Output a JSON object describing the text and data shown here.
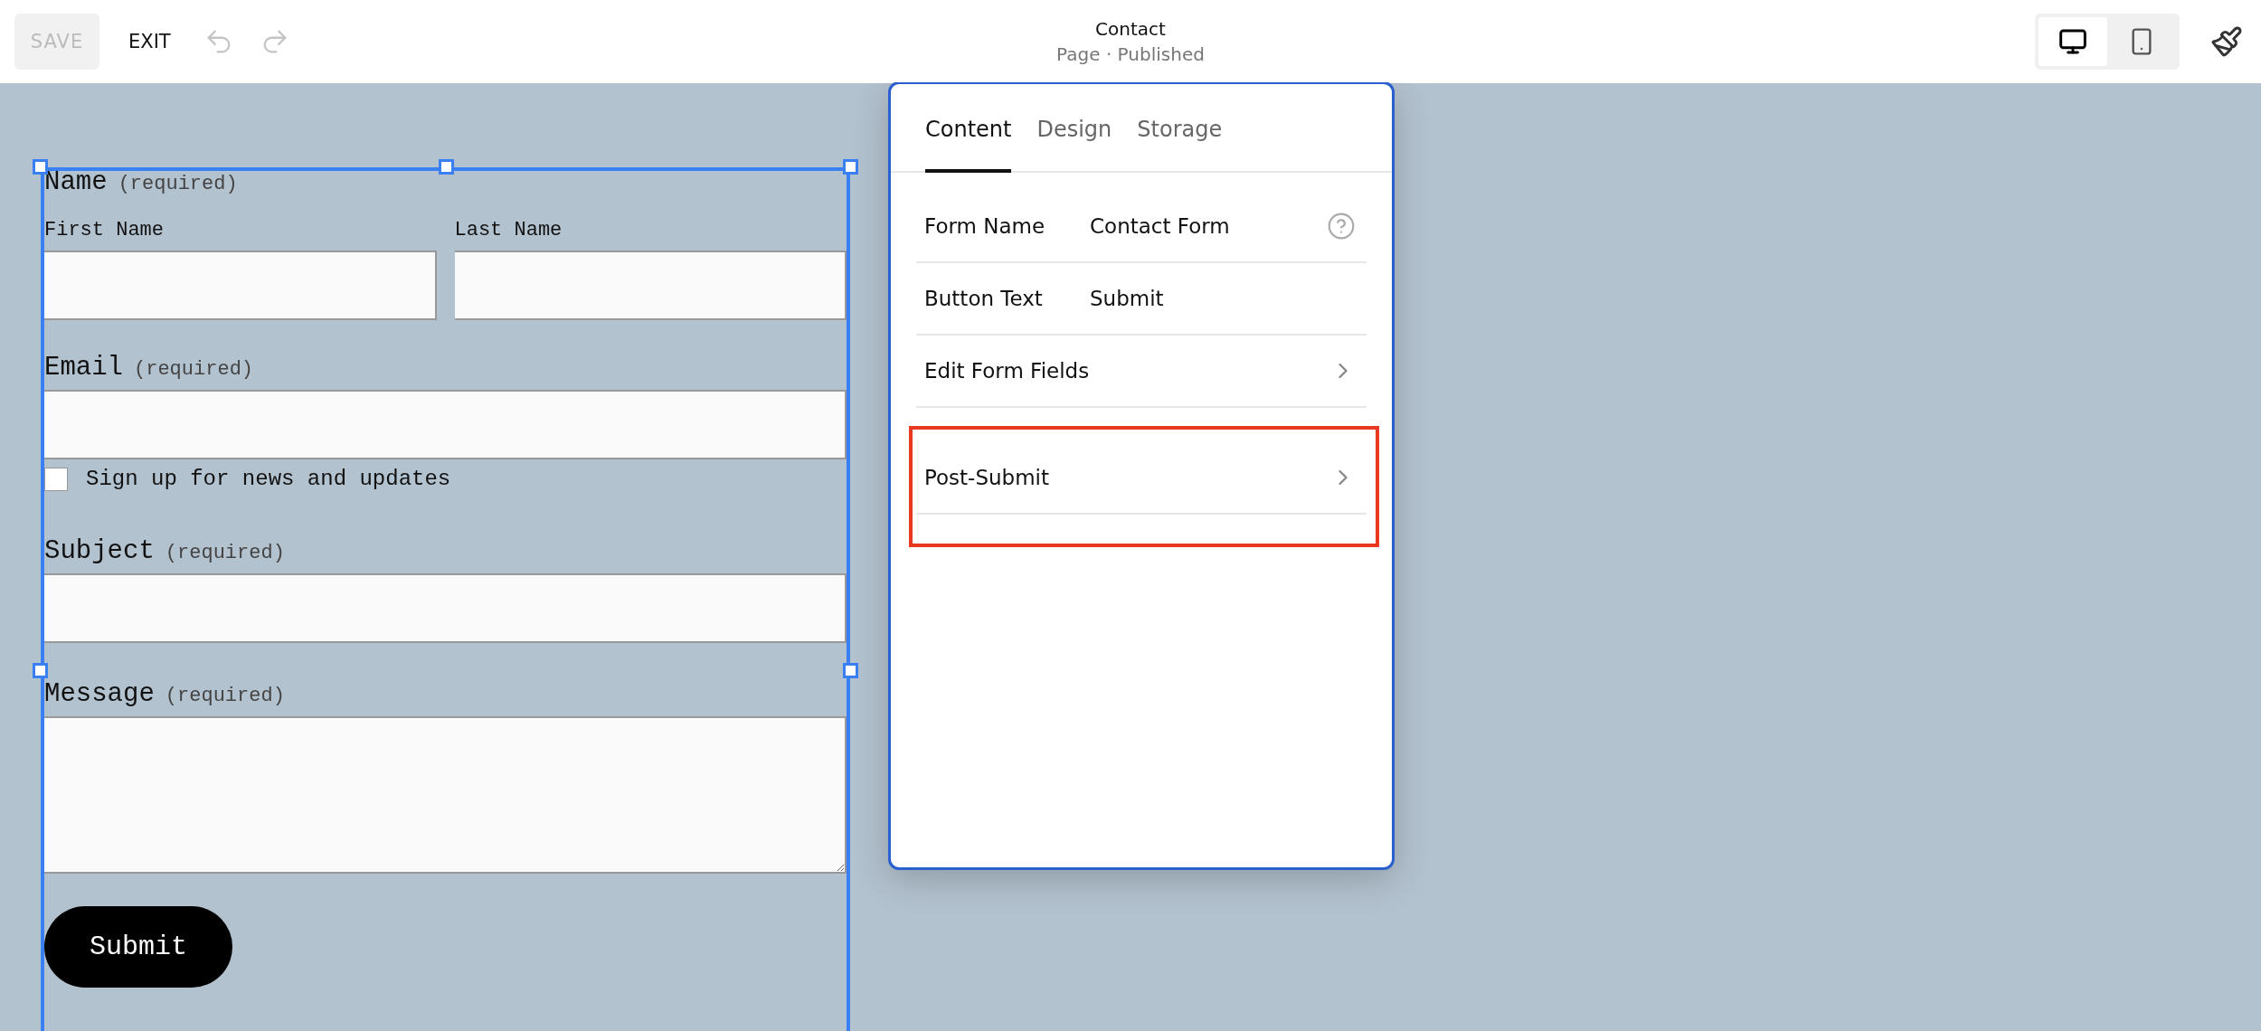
{
  "top_bar": {
    "save": {
      "label": "SAVE",
      "disabled": true
    },
    "exit": {
      "label": "EXIT"
    },
    "undo": {
      "disabled": true
    },
    "redo": {
      "disabled": true
    },
    "title": "Contact",
    "subtitle": "Page · Published",
    "view_modes": [
      {
        "kind": "desktop",
        "selected": true
      },
      {
        "kind": "mobile",
        "selected": false
      }
    ]
  },
  "form": {
    "fields": [
      {
        "kind": "name",
        "label": "Name",
        "note": "(required)",
        "parts": [
          "First Name",
          "Last Name"
        ]
      },
      {
        "kind": "text",
        "label": "Email",
        "note": "(required)"
      },
      {
        "kind": "checkbox",
        "label": "Sign up for news and updates",
        "checked": false
      },
      {
        "kind": "text",
        "label": "Subject",
        "note": "(required)"
      },
      {
        "kind": "textarea",
        "label": "Message",
        "note": "(required)"
      }
    ],
    "submit": "Submit"
  },
  "panel": {
    "tabs": [
      {
        "label": "Content",
        "selected": true
      },
      {
        "label": "Design",
        "selected": false
      },
      {
        "label": "Storage",
        "selected": false
      }
    ],
    "rows": [
      {
        "kind": "field",
        "label": "Form Name",
        "value": "Contact Form",
        "help": true,
        "highlighted": false
      },
      {
        "kind": "field",
        "label": "Button Text",
        "value": "Submit",
        "help": false,
        "highlighted": false
      },
      {
        "kind": "nav",
        "label": "Edit Form Fields",
        "highlighted": false
      },
      {
        "kind": "nav",
        "label": "Post-Submit",
        "highlighted": true
      }
    ]
  }
}
